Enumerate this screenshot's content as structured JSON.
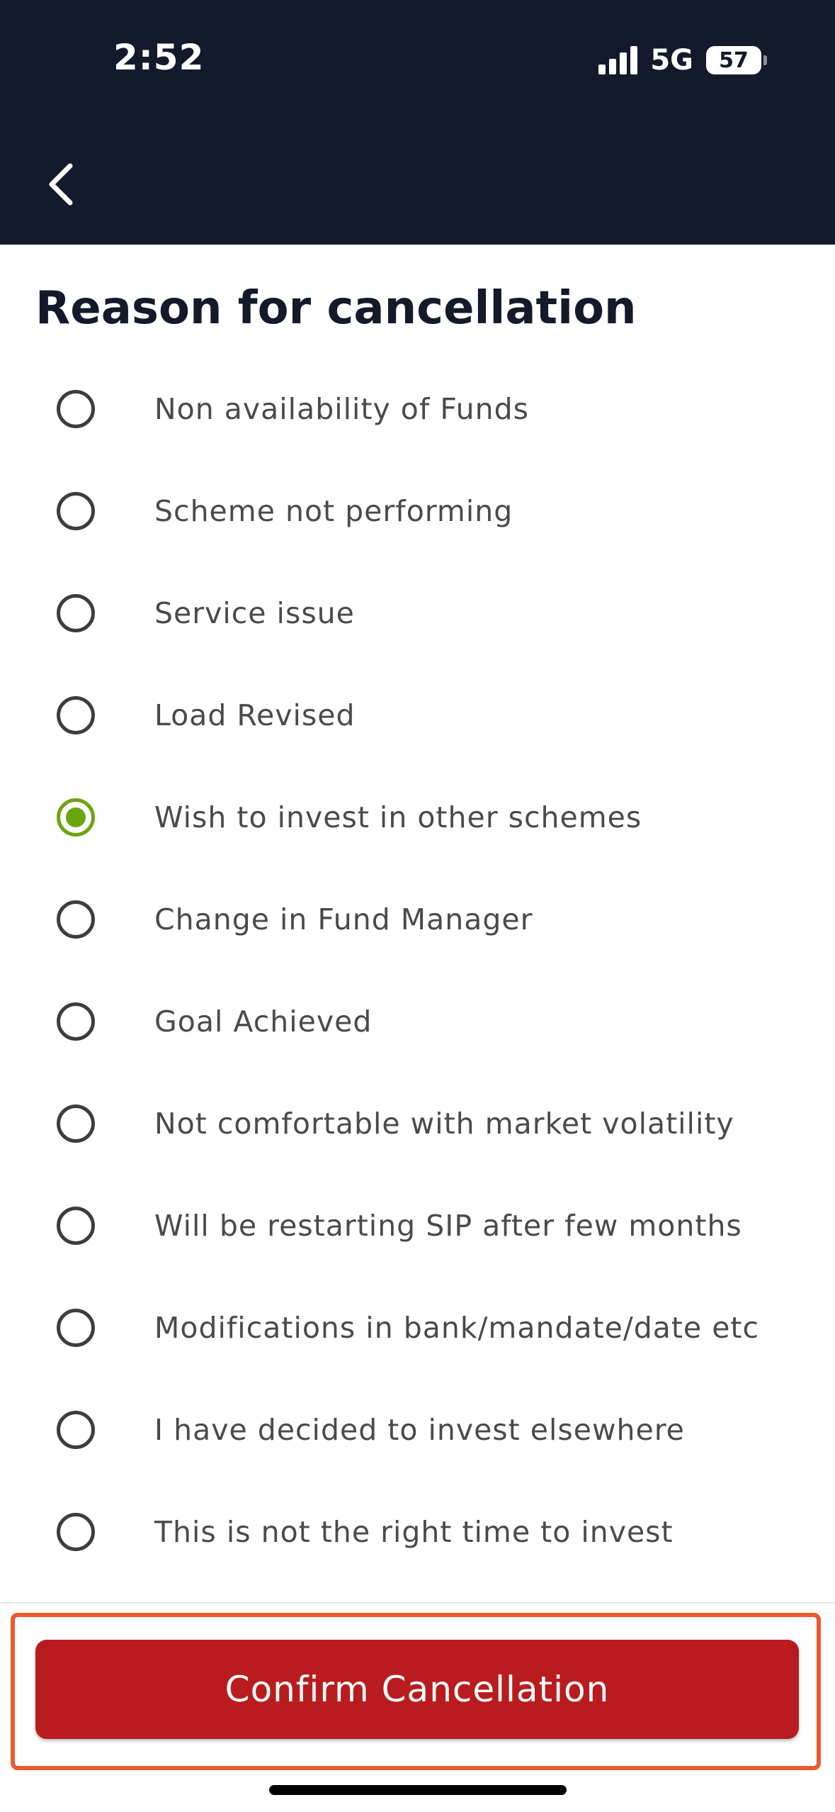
{
  "status_bar": {
    "time": "2:52",
    "network": "5G",
    "battery": "57",
    "signal_bars": 4
  },
  "header": {
    "background_color": "#131a2b",
    "back_icon": "chevron-left-icon"
  },
  "page": {
    "title": "Reason for cancellation"
  },
  "reasons": [
    {
      "label": "Non availability of Funds",
      "selected": false
    },
    {
      "label": "Scheme not performing",
      "selected": false
    },
    {
      "label": "Service issue",
      "selected": false
    },
    {
      "label": "Load Revised",
      "selected": false
    },
    {
      "label": "Wish to invest in other schemes",
      "selected": true
    },
    {
      "label": "Change in Fund Manager",
      "selected": false
    },
    {
      "label": "Goal Achieved",
      "selected": false
    },
    {
      "label": "Not comfortable with market volatility",
      "selected": false
    },
    {
      "label": "Will be restarting SIP after few months",
      "selected": false
    },
    {
      "label": "Modifications in bank/mandate/date etc",
      "selected": false
    },
    {
      "label": "I have decided to invest elsewhere",
      "selected": false
    },
    {
      "label": "This is not the right time to invest",
      "selected": false
    }
  ],
  "footer": {
    "confirm_label": "Confirm Cancellation"
  },
  "colors": {
    "selected_radio": "#6aa50e",
    "confirm_button": "#b91c1e",
    "highlight_frame": "#ea5a30"
  }
}
